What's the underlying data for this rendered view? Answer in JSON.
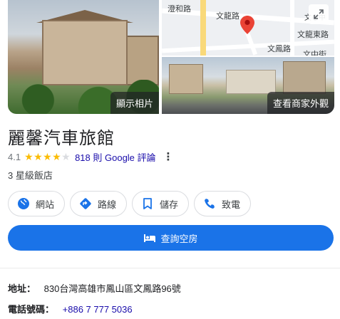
{
  "photos": {
    "view_photos_label": "顯示相片",
    "view_exterior_label": "查看商家外觀"
  },
  "map": {
    "labels": [
      "澄和路",
      "文龍路",
      "文龍東路",
      "文鳳路",
      "文中街",
      "文心中"
    ]
  },
  "place": {
    "name": "麗馨汽車旅館",
    "rating": "4.1",
    "stars_filled": 4,
    "stars_total": 5,
    "reviews_text": "818 則 Google 評論",
    "hotel_class": "3 星級飯店"
  },
  "actions": [
    {
      "label": "網站",
      "icon": "globe-icon"
    },
    {
      "label": "路線",
      "icon": "directions-icon"
    },
    {
      "label": "儲存",
      "icon": "bookmark-icon"
    },
    {
      "label": "致電",
      "icon": "phone-icon"
    }
  ],
  "primary_action": {
    "label": "查詢空房",
    "icon": "bed-icon"
  },
  "info": {
    "address_label": "地址：",
    "address_value": "830台灣高雄市鳳山區文鳳路96號",
    "phone_label": "電話號碼：",
    "phone_value": "+886 7 777 5036"
  },
  "colors": {
    "accent": "#1a73e8",
    "link": "#1a0dab",
    "star": "#fbbc04",
    "pin": "#ea4335"
  }
}
